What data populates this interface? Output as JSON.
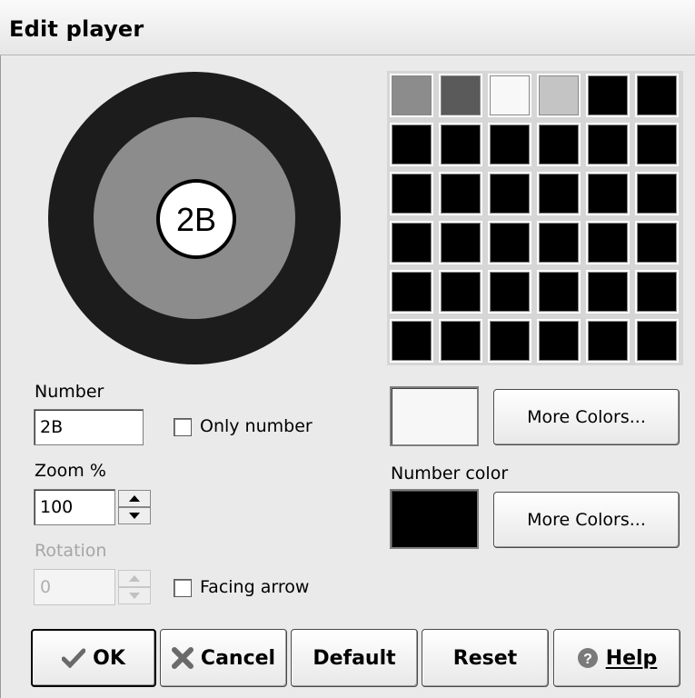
{
  "window": {
    "title": "Edit player"
  },
  "preview": {
    "player_label": "2B"
  },
  "palette": {
    "rows": [
      [
        "#8c8c8c",
        "#5a5a5a",
        "#f8f8f8",
        "#c4c4c4",
        "#000000",
        "#000000"
      ],
      [
        "#000000",
        "#000000",
        "#000000",
        "#000000",
        "#000000",
        "#000000"
      ],
      [
        "#000000",
        "#000000",
        "#000000",
        "#000000",
        "#000000",
        "#000000"
      ],
      [
        "#000000",
        "#000000",
        "#000000",
        "#000000",
        "#000000",
        "#000000"
      ],
      [
        "#000000",
        "#000000",
        "#000000",
        "#000000",
        "#000000",
        "#000000"
      ],
      [
        "#000000",
        "#000000",
        "#000000",
        "#000000",
        "#000000",
        "#000000"
      ]
    ]
  },
  "form": {
    "number_label": "Number",
    "number_value": "2B",
    "only_number_label": "Only number",
    "zoom_label": "Zoom %",
    "zoom_value": "100",
    "rotation_label": "Rotation",
    "rotation_value": "0",
    "facing_arrow_label": "Facing arrow"
  },
  "colors": {
    "player_color": "#f7f7f7",
    "number_color_label": "Number color",
    "number_color": "#000000",
    "more_colors_label": "More Colors...",
    "more_colors_label_2": "More Colors..."
  },
  "buttons": {
    "ok": "OK",
    "cancel": "Cancel",
    "default": "Default",
    "reset": "Reset",
    "help": "Help"
  }
}
